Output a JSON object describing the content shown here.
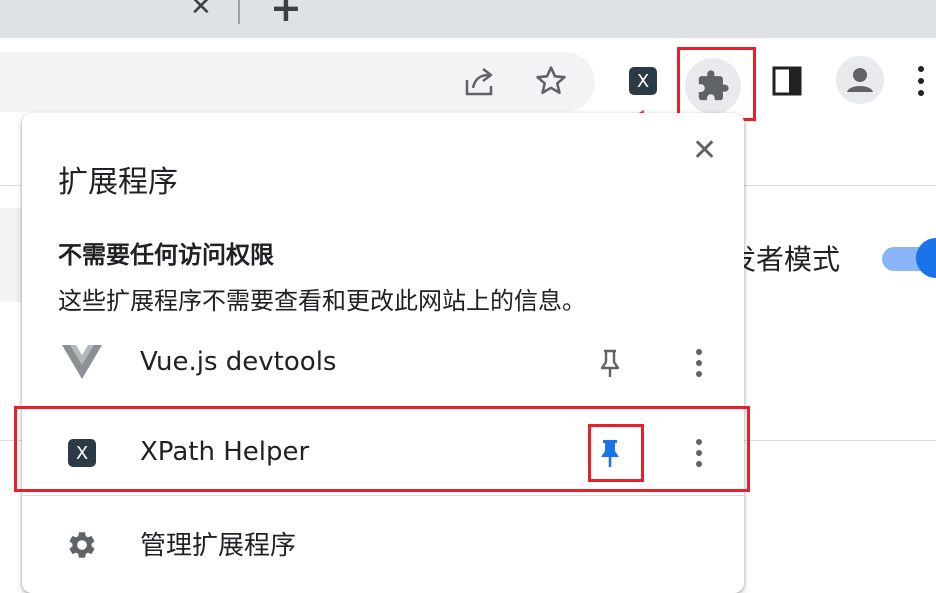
{
  "tabstrip": {
    "close_glyph": "✕",
    "new_tab_glyph": "+"
  },
  "toolbar": {
    "icons": [
      "share-icon",
      "star-bookmark-icon",
      "xpath-helper-extension-icon",
      "extensions-puzzle-icon",
      "side-panel-icon",
      "profile-avatar-icon",
      "chrome-menu-icon"
    ],
    "xpath_icon_glyph": "X"
  },
  "background": {
    "dev_mode_label": "发者模式"
  },
  "panel": {
    "title": "扩展程序",
    "close_glyph": "✕",
    "section_heading": "不需要任何访问权限",
    "section_desc": "这些扩展程序不需要查看和更改此网站上的信息。",
    "extensions": [
      {
        "name": "Vue.js devtools",
        "pinned": false,
        "icon": "vue-logo-icon"
      },
      {
        "name": "XPath Helper",
        "pinned": true,
        "icon": "xpath-helper-icon",
        "icon_glyph": "X"
      }
    ],
    "manage_label": "管理扩展程序"
  },
  "colors": {
    "accent": "#1a73e8",
    "highlight_box": "#e8202a",
    "tabstrip": "#dee1e6",
    "omnibox": "#f1f3f4"
  }
}
